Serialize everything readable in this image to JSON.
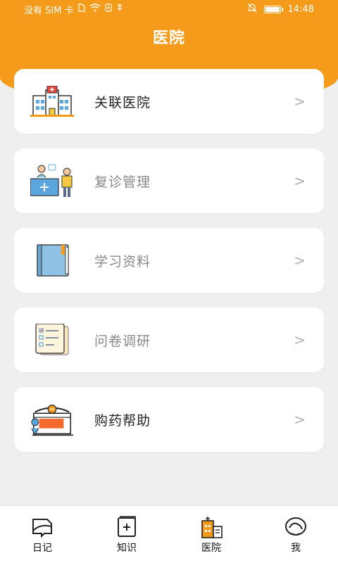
{
  "status_bar": {
    "carrier": "没有 SIM 卡",
    "time": "14:48"
  },
  "header": {
    "title": "医院"
  },
  "menu": [
    {
      "label": "关联医院",
      "icon": "hospital-building-icon",
      "state": "active"
    },
    {
      "label": "复诊管理",
      "icon": "doctor-consultation-icon",
      "state": "muted"
    },
    {
      "label": "学习资料",
      "icon": "notebook-icon",
      "state": "muted"
    },
    {
      "label": "问卷调研",
      "icon": "checklist-icon",
      "state": "muted"
    },
    {
      "label": "购药帮助",
      "icon": "pharmacy-store-icon",
      "state": "active"
    }
  ],
  "chevron_glyph": ">",
  "bottom_nav": [
    {
      "label": "日记",
      "icon": "diary-icon"
    },
    {
      "label": "知识",
      "icon": "knowledge-book-icon"
    },
    {
      "label": "医院",
      "icon": "hospital-icon"
    },
    {
      "label": "我",
      "icon": "profile-icon"
    }
  ],
  "colors": {
    "accent": "#f59b1a",
    "background": "#efefef",
    "card": "#ffffff"
  }
}
